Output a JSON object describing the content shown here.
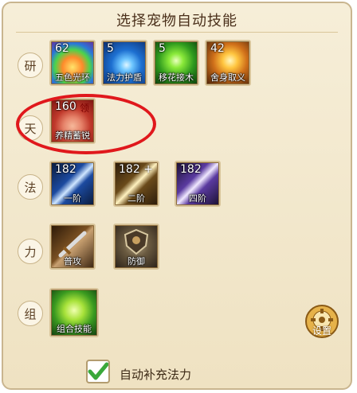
{
  "title": "选择宠物自动技能",
  "rows": [
    {
      "tag": "研",
      "skills": [
        {
          "count": "62",
          "label": "五色光环"
        },
        {
          "count": "5",
          "label": "法力护盾"
        },
        {
          "count": "5",
          "label": "移花接木"
        },
        {
          "count": "42",
          "label": "舍身取义"
        }
      ]
    },
    {
      "tag": "天",
      "skills": [
        {
          "count": "160",
          "mark": "领",
          "label": "养精蓄锐"
        }
      ]
    },
    {
      "tag": "法",
      "skills": [
        {
          "count": "182",
          "label": "一阶"
        },
        {
          "count": "182",
          "plus": "+",
          "label": "二阶"
        },
        {
          "count": "182",
          "label": "四阶"
        }
      ]
    },
    {
      "tag": "力",
      "skills": [
        {
          "label": "普攻"
        },
        {
          "label": "防御"
        }
      ]
    },
    {
      "tag": "组",
      "skills": [
        {
          "label": "组合技能"
        }
      ]
    }
  ],
  "settings_label": "设置",
  "auto_refill": {
    "label": "自动补充法力",
    "checked": true
  },
  "colors": {
    "highlight": "#e0181c",
    "check": "#3aa83a"
  },
  "icons": {
    "settings": "gear-icon",
    "checkbox": "checkmark-icon"
  }
}
